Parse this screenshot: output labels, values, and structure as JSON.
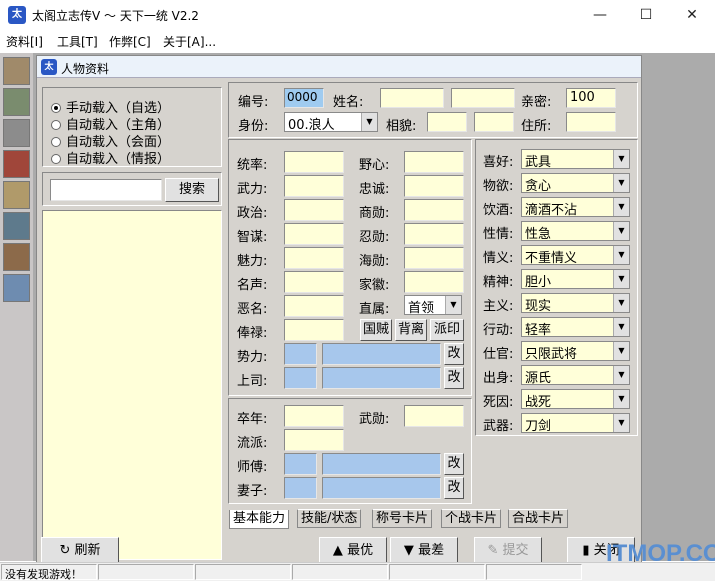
{
  "window": {
    "title": "太阁立志传V ～ 天下一统 V2.2",
    "minimize": "—",
    "maximize": "☐",
    "close": "✕"
  },
  "menu": [
    "资料[I]",
    "工具[T]",
    "作弊[C]",
    "关于[A]..."
  ],
  "child": {
    "title": "人物资料"
  },
  "load_options": [
    {
      "label": "手动载入（自选）",
      "selected": true
    },
    {
      "label": "自动载入（主角）",
      "selected": false
    },
    {
      "label": "自动载入（会面）",
      "selected": false
    },
    {
      "label": "自动载入（情报）",
      "selected": false
    }
  ],
  "search": {
    "value": "",
    "button": "搜索"
  },
  "header": {
    "id_label": "编号:",
    "id_value": "0000",
    "name_label": "姓名:",
    "name_value1": "",
    "name_value2": "",
    "intimacy_label": "亲密:",
    "intimacy_value": "100",
    "identity_label": "身份:",
    "identity_value": "00.浪人",
    "looks_label": "相貌:",
    "looks_value1": "",
    "looks_value2": "",
    "residence_label": "住所:",
    "residence_value": ""
  },
  "stats_left": [
    {
      "label": "统率:",
      "value": ""
    },
    {
      "label": "武力:",
      "value": ""
    },
    {
      "label": "政治:",
      "value": ""
    },
    {
      "label": "智谋:",
      "value": ""
    },
    {
      "label": "魅力:",
      "value": ""
    },
    {
      "label": "名声:",
      "value": ""
    },
    {
      "label": "恶名:",
      "value": ""
    },
    {
      "label": "俸禄:",
      "value": ""
    }
  ],
  "stats_mid": [
    {
      "label": "野心:",
      "value": ""
    },
    {
      "label": "忠诚:",
      "value": ""
    },
    {
      "label": "商勋:",
      "value": ""
    },
    {
      "label": "忍勋:",
      "value": ""
    },
    {
      "label": "海勋:",
      "value": ""
    },
    {
      "label": "家徽:",
      "value": ""
    }
  ],
  "affiliation": {
    "label": "直属:",
    "value": "首领"
  },
  "action_buttons": [
    "国贼",
    "背离",
    "派印"
  ],
  "power": {
    "label": "势力:",
    "edit": "改"
  },
  "superior": {
    "label": "上司:",
    "edit": "改"
  },
  "bottom_group": {
    "birth_label": "卒年:",
    "birth_value": "",
    "merit_label": "武勋:",
    "merit_value": "",
    "school_label": "流派:",
    "school_value": "",
    "master_label": "师傅:",
    "master_edit": "改",
    "spouse_label": "妻子:",
    "spouse_edit": "改"
  },
  "traits": [
    {
      "label": "喜好:",
      "value": "武具"
    },
    {
      "label": "物欲:",
      "value": "贪心"
    },
    {
      "label": "饮酒:",
      "value": "滴酒不沾"
    },
    {
      "label": "性情:",
      "value": "性急"
    },
    {
      "label": "情义:",
      "value": "不重情义"
    },
    {
      "label": "精神:",
      "value": "胆小"
    },
    {
      "label": "主义:",
      "value": "现实"
    },
    {
      "label": "行动:",
      "value": "轻率"
    },
    {
      "label": "仕官:",
      "value": "只限武将"
    },
    {
      "label": "出身:",
      "value": "源氏"
    },
    {
      "label": "死因:",
      "value": "战死"
    },
    {
      "label": "武器:",
      "value": "刀剑"
    }
  ],
  "tabs": [
    "基本能力",
    "技能/状态",
    "称号卡片",
    "个战卡片",
    "合战卡片"
  ],
  "bottom_buttons": {
    "refresh": "刷新",
    "best": "最优",
    "worst": "最差",
    "submit": "提交",
    "close": "关闭"
  },
  "status": {
    "text": "没有发现游戏！"
  },
  "watermark": "ITMOP.COM"
}
